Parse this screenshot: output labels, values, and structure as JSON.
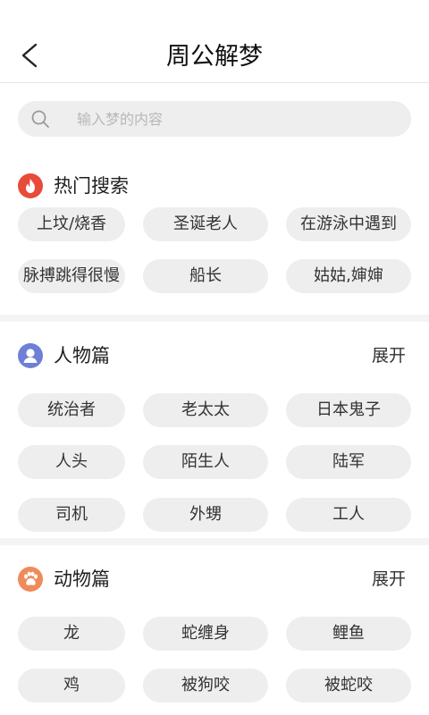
{
  "header": {
    "title": "周公解梦",
    "back_icon": "chevron-left-icon"
  },
  "search": {
    "placeholder": "输入梦的内容",
    "value": "",
    "icon": "search-icon"
  },
  "sections": [
    {
      "title": "热门搜索",
      "icon": "flame-icon",
      "icon_color": "#e84b3a",
      "expand_label": "",
      "tags": [
        "上坟/烧香",
        "圣诞老人",
        "在游泳中遇到",
        "脉搏跳得很慢",
        "船长",
        "姑姑,婶婶"
      ]
    },
    {
      "title": "人物篇",
      "icon": "person-icon",
      "icon_color": "#6e7fd6",
      "expand_label": "展开",
      "tags": [
        "统治者",
        "老太太",
        "日本鬼子",
        "人头",
        "陌生人",
        "陆军",
        "司机",
        "外甥",
        "工人"
      ]
    },
    {
      "title": "动物篇",
      "icon": "paw-icon",
      "icon_color": "#ef8a5a",
      "expand_label": "展开",
      "tags": [
        "龙",
        "蛇缠身",
        "鲤鱼",
        "鸡",
        "被狗咬",
        "被蛇咬"
      ]
    }
  ],
  "colors": {
    "tag_background": "#eeeeee",
    "divider": "#f4f4f4"
  }
}
